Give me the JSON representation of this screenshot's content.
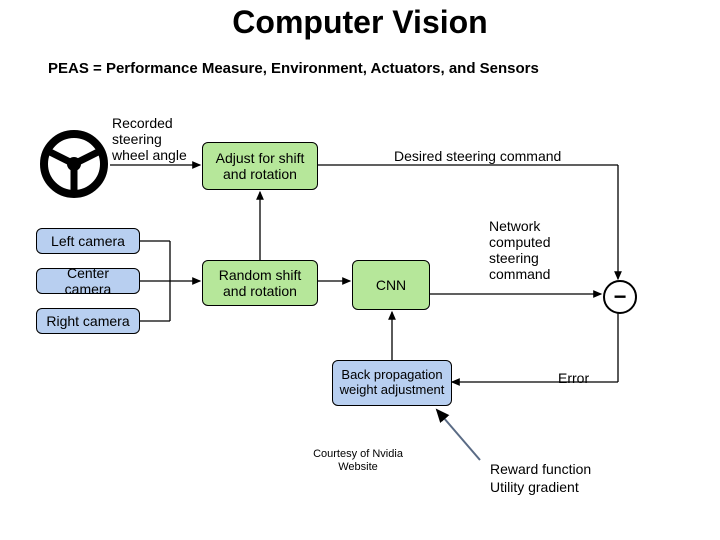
{
  "title": "Computer Vision",
  "subtitle": {
    "lead": "PEAS = ",
    "rest": "Performance Measure, Environment, Actuators, and Sensors"
  },
  "labels": {
    "recorded": "Recorded\nsteering\nwheel angle",
    "desired": "Desired steering command",
    "network": "Network\ncomputed\nsteering\ncommand",
    "error": "Error"
  },
  "boxes": {
    "adjust": "Adjust for shift\nand rotation",
    "left_cam": "Left camera",
    "center_cam": "Center camera",
    "right_cam": "Right camera",
    "random_shift": "Random shift\nand rotation",
    "cnn": "CNN",
    "backprop": "Back propagation\nweight adjustment"
  },
  "credit": "Courtesy of Nvidia\nWebsite",
  "reward": "Reward function\nUtility gradient",
  "icons": {
    "wheel": "steering-wheel-icon",
    "minus": "−"
  },
  "colors": {
    "green": "#b6e79a",
    "blue": "#b8cff0"
  }
}
